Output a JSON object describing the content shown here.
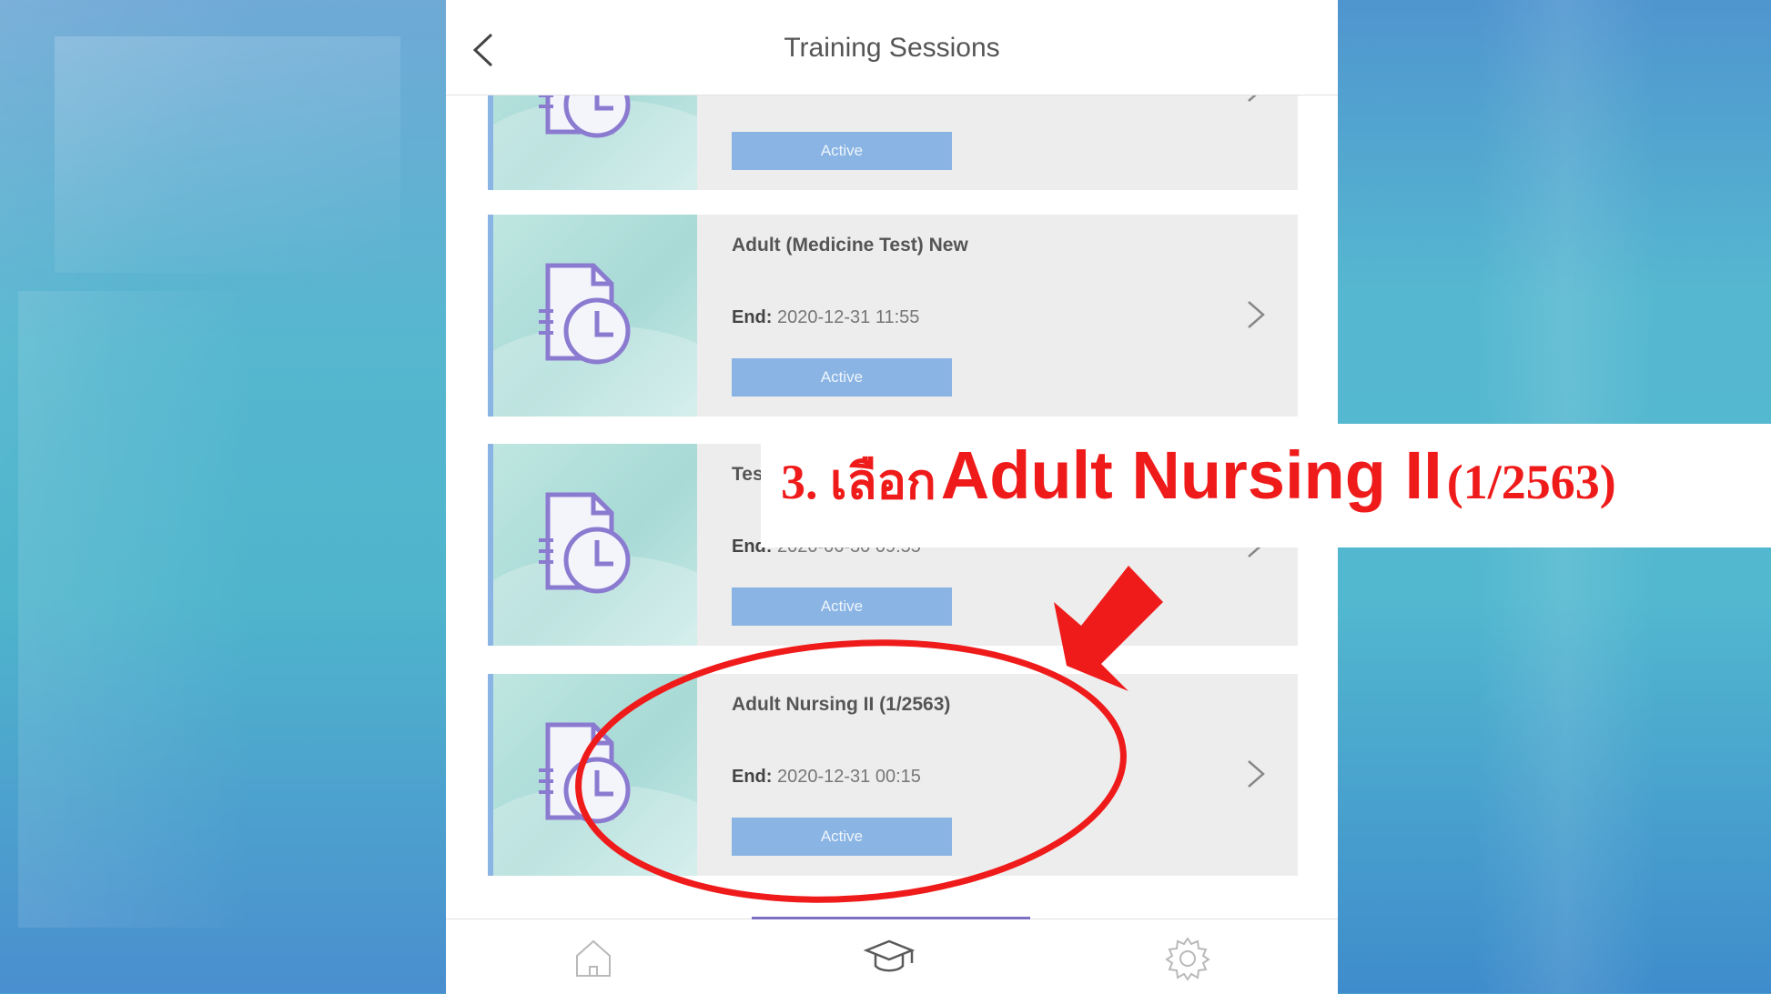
{
  "header": {
    "title": "Training Sessions"
  },
  "sessions": [
    {
      "title": "",
      "end_label": "",
      "end_value": "",
      "status": "Active"
    },
    {
      "title": "Adult (Medicine Test) New",
      "end_label": "End:",
      "end_value": "2020-12-31 11:55",
      "status": "Active"
    },
    {
      "title": "Test",
      "end_label": "End:",
      "end_value": "2020-06-30 09:55",
      "status": "Active"
    },
    {
      "title": "Adult Nursing II (1/2563)",
      "end_label": "End:",
      "end_value": "2020-12-31 00:15",
      "status": "Active"
    }
  ],
  "tabs": [
    {
      "icon": "home-icon"
    },
    {
      "icon": "graduation-cap-icon",
      "active": true
    },
    {
      "icon": "gear-icon"
    }
  ],
  "annotation": {
    "step": "3. เลือก",
    "course_name": "Adult Nursing II",
    "term": "(1/2563)",
    "color": "#ef1b1b"
  },
  "colors": {
    "accent": "#8ab4e3",
    "tab_indicator": "#7d6ec4",
    "thumb": "#bfe6e1"
  }
}
